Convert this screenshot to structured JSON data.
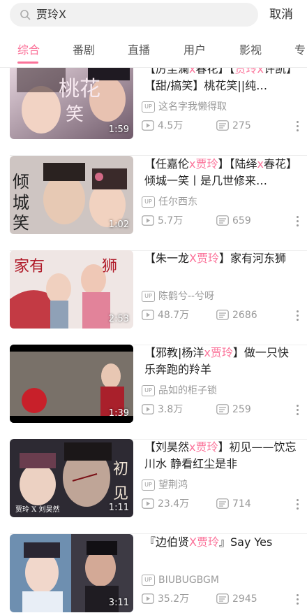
{
  "search": {
    "query": "贾玲X",
    "cancel_label": "取消"
  },
  "tabs": [
    {
      "label": "综合",
      "active": true
    },
    {
      "label": "番剧",
      "active": false
    },
    {
      "label": "直播",
      "active": false
    },
    {
      "label": "用户",
      "active": false
    },
    {
      "label": "影视",
      "active": false
    },
    {
      "label": "专",
      "active": false
    }
  ],
  "colors": {
    "accent": "#fb7299",
    "meta_text": "#9a9a9a"
  },
  "videos": [
    {
      "title_parts": [
        {
          "text": "【厉尘澜",
          "kw": false
        },
        {
          "text": "x",
          "kw": true
        },
        {
          "text": "春花】【",
          "kw": false
        },
        {
          "text": "贾玲",
          "kw": true
        },
        {
          "text": "x",
          "kw": true
        },
        {
          "text": "许凯】【甜/搞笑】桃花笑||纯…",
          "kw": false
        }
      ],
      "uploader": "这名字我懒得取",
      "views": "4.5万",
      "danmaku": "275",
      "duration": "1:59"
    },
    {
      "title_parts": [
        {
          "text": "【任嘉伦",
          "kw": false
        },
        {
          "text": "x",
          "kw": true
        },
        {
          "text": "贾玲",
          "kw": true
        },
        {
          "text": "】【陆绎",
          "kw": false
        },
        {
          "text": "x",
          "kw": true
        },
        {
          "text": "春花】倾城一笑丨是几世修来…",
          "kw": false
        }
      ],
      "uploader": "任尔西东",
      "views": "5.7万",
      "danmaku": "659",
      "duration": "1:02"
    },
    {
      "title_parts": [
        {
          "text": "【朱一龙",
          "kw": false
        },
        {
          "text": "X",
          "kw": true
        },
        {
          "text": "贾玲",
          "kw": true
        },
        {
          "text": "】家有河东狮",
          "kw": false
        }
      ],
      "uploader": "陈鹤兮--兮呀",
      "views": "48.7万",
      "danmaku": "2686",
      "duration": "2:53"
    },
    {
      "title_parts": [
        {
          "text": "【邪教|杨洋",
          "kw": false
        },
        {
          "text": "x",
          "kw": true
        },
        {
          "text": "贾玲",
          "kw": true
        },
        {
          "text": "】做一只快乐奔跑的羚羊",
          "kw": false
        }
      ],
      "uploader": "品如的柜子锁",
      "views": "3.8万",
      "danmaku": "259",
      "duration": "1:39"
    },
    {
      "title_parts": [
        {
          "text": "【刘昊然",
          "kw": false
        },
        {
          "text": "x",
          "kw": true
        },
        {
          "text": "贾玲",
          "kw": true
        },
        {
          "text": "】初见——饮忘川水 静看红尘是非",
          "kw": false
        }
      ],
      "uploader": "望荆鸿",
      "views": "23.4万",
      "danmaku": "714",
      "duration": "1:11"
    },
    {
      "title_parts": [
        {
          "text": "『边伯贤",
          "kw": false
        },
        {
          "text": "X",
          "kw": true
        },
        {
          "text": "贾玲",
          "kw": true
        },
        {
          "text": "』Say Yes",
          "kw": false
        }
      ],
      "uploader": "BIUBUGBGM",
      "views": "35.2万",
      "danmaku": "2945",
      "duration": "3:11"
    }
  ]
}
